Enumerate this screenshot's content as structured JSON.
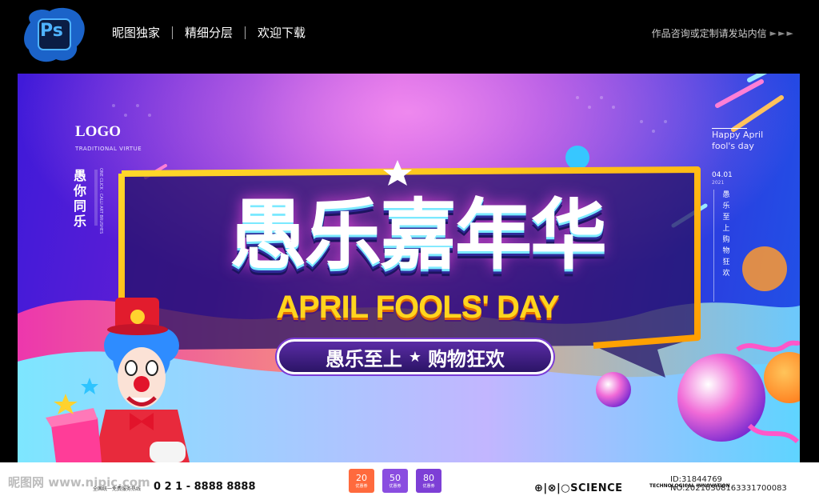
{
  "topbar": {
    "ps_icon_text": "Ps",
    "nav": [
      "昵图独家",
      "精细分层",
      "欢迎下载"
    ],
    "right_text": "作品咨询或定制请发站内信",
    "arrows": "►►►"
  },
  "banner": {
    "logo": "LOGO",
    "logo_sub": "TRADITIONAL VIRTUE",
    "vertical_cn": "愚你同乐",
    "vertical_en": "ONE CLICK · CALLI ART BRUSHES",
    "right_happy": "Happy April fool's day",
    "right_date": "04.01",
    "right_year": "2021",
    "right_vertical": "愚乐至上购物狂欢",
    "main_title": "愚乐嘉年华",
    "en_title": "APRIL FOOLS' DAY",
    "slogan_left": "愚乐至上",
    "slogan_star": "★",
    "slogan_right": "购物狂欢"
  },
  "footer": {
    "watermark": "昵图网 www.nipic.com",
    "phone_label": "全国统一免费服务热线",
    "phone": "0 2 1 - 8888  8888",
    "coupons": [
      {
        "value": "20",
        "label": "优惠券",
        "color": "#ff6a3d"
      },
      {
        "value": "50",
        "label": "优惠券",
        "color": "#8a4de0"
      },
      {
        "value": "80",
        "label": "优惠券",
        "color": "#7d3fd6"
      }
    ],
    "science": "⊕|⊗|○SCIENCE",
    "science_sub": "TECHNOLOGICAL INNOVATION",
    "image_id": "ID:31844769 NO:20210308163331700083"
  }
}
